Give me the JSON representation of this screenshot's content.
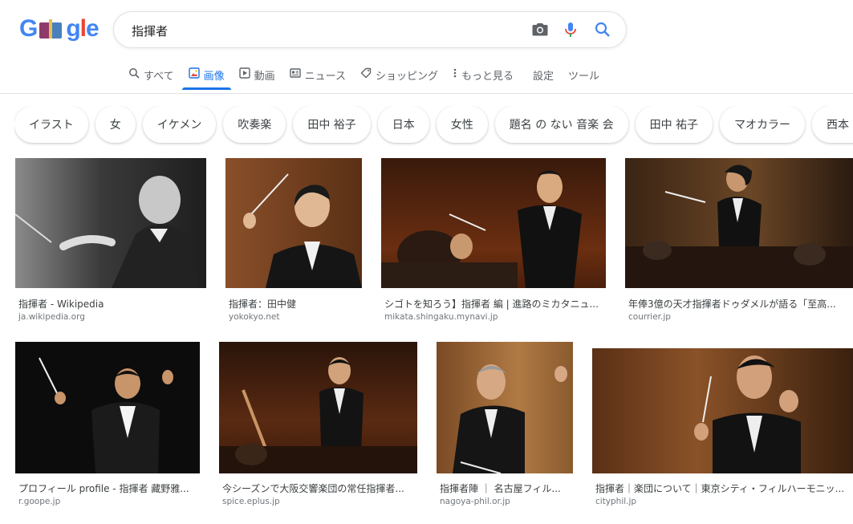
{
  "search": {
    "query": "指揮者"
  },
  "tabs": [
    {
      "label": "すべて"
    },
    {
      "label": "画像"
    },
    {
      "label": "動画"
    },
    {
      "label": "ニュース"
    },
    {
      "label": "ショッピング"
    },
    {
      "label": "もっと見る"
    },
    {
      "label": "設定"
    },
    {
      "label": "ツール"
    }
  ],
  "chips": [
    "イラスト",
    "女",
    "イケメン",
    "吹奏楽",
    "田中 裕子",
    "日本",
    "女性",
    "題名 の ない 音楽 会",
    "田中 祐子",
    "マオカラー",
    "西本 智実"
  ],
  "results": [
    {
      "caption": "指揮者 - Wikipedia",
      "site": "ja.wikipedia.org"
    },
    {
      "caption": "指揮者：田中健",
      "site": "yokokyo.net"
    },
    {
      "caption": "シゴトを知ろう】指揮者 編 | 進路のミカタニュ...",
      "site": "mikata.shingaku.mynavi.jp"
    },
    {
      "caption": "年俸3億の天才指揮者ドゥダメルが語る「至高...",
      "site": "courrier.jp"
    },
    {
      "caption": "プロフィール profile - 指揮者 藏野雅...",
      "site": "r.goope.jp"
    },
    {
      "caption": "今シーズンで大阪交響楽団の常任指揮者...",
      "site": "spice.eplus.jp"
    },
    {
      "caption": "指揮者陣 ｜ 名古屋フィル...",
      "site": "nagoya-phil.or.jp"
    },
    {
      "caption": "指揮者｜楽団について｜東京シティ・フィルハーモニッ...",
      "site": "cityphil.jp"
    }
  ]
}
